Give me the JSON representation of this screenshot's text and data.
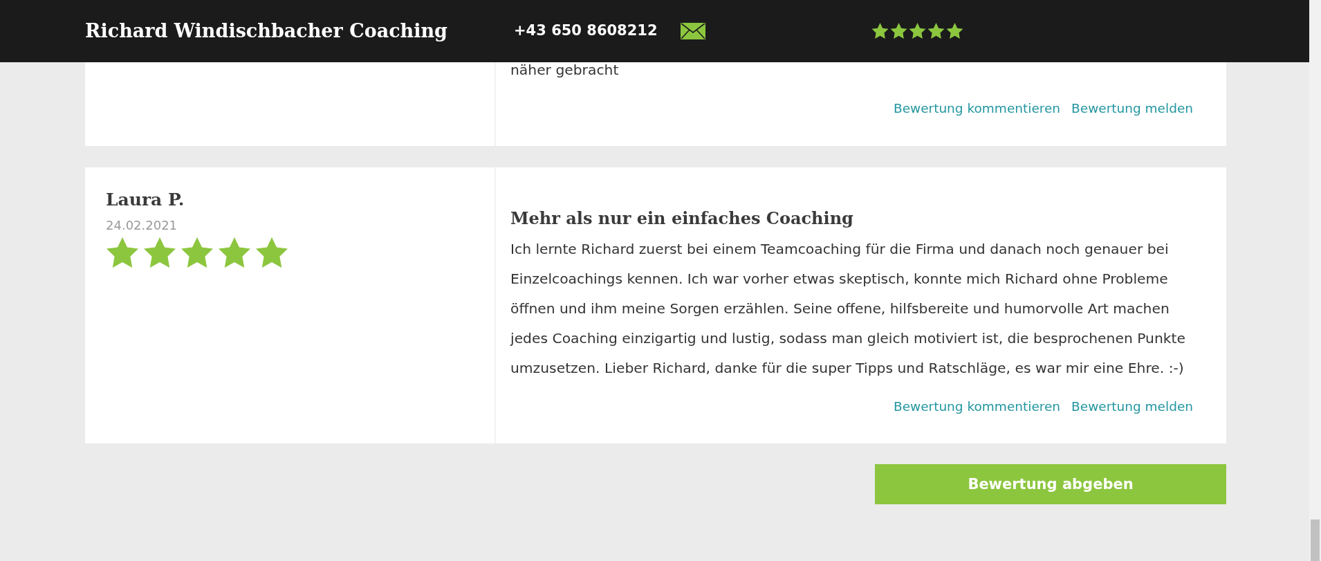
{
  "header": {
    "title": "Richard Windischbacher Coaching",
    "phone": "+43 650 8608212",
    "stars": 5
  },
  "reviews": [
    {
      "text": "näher gebracht",
      "actions": [
        "Bewertung kommentieren",
        "Bewertung melden"
      ]
    },
    {
      "author": "Laura P.",
      "date": "24.02.2021",
      "stars": 5,
      "title": "Mehr als nur ein einfaches Coaching",
      "text": "Ich lernte Richard zuerst bei einem Teamcoaching für die Firma und danach noch genauer bei Einzelcoachings kennen. Ich war vorher etwas skeptisch, konnte mich Richard ohne Probleme öffnen und ihm meine Sorgen erzählen. Seine offene, hilfsbereite und humorvolle Art machen jedes Coaching einzigartig und lustig, sodass man gleich motiviert ist, die besprochenen Punkte umzusetzen. Lieber Richard, danke für die super Tipps und Ratschläge, es war mir eine Ehre. :-)",
      "actions": [
        "Bewertung kommentieren",
        "Bewertung melden"
      ]
    }
  ],
  "submit_button": "Bewertung abgeben"
}
